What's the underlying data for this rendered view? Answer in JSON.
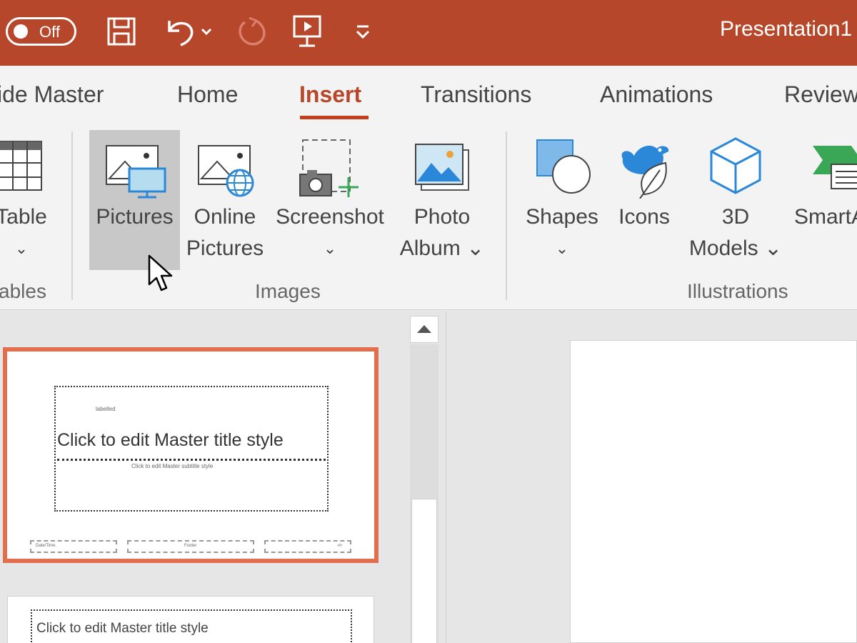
{
  "titlebar": {
    "autosave_label": "Off",
    "document_title": "Presentation1",
    "qat": [
      "save-icon",
      "undo-icon",
      "redo-icon",
      "present-icon",
      "customize-qat-icon"
    ]
  },
  "tabs": [
    {
      "label": "ide Master",
      "active": false
    },
    {
      "label": "Home",
      "active": false
    },
    {
      "label": "Insert",
      "active": true
    },
    {
      "label": "Transitions",
      "active": false
    },
    {
      "label": "Animations",
      "active": false
    },
    {
      "label": "Review",
      "active": false
    }
  ],
  "ribbon": {
    "groups": {
      "tables": "ables",
      "images": "Images",
      "illustrations": "Illustrations"
    },
    "buttons": {
      "table": {
        "line1": "Table",
        "line2": "⌄"
      },
      "pictures": {
        "line1": "Pictures"
      },
      "online_pictures": {
        "line1": "Online",
        "line2": "Pictures"
      },
      "screenshot": {
        "line1": "Screenshot",
        "line2": "⌄"
      },
      "photo_album": {
        "line1": "Photo",
        "line2": "Album ⌄"
      },
      "shapes": {
        "line1": "Shapes",
        "line2": "⌄"
      },
      "icons": {
        "line1": "Icons"
      },
      "models_3d": {
        "line1": "3D",
        "line2": "Models ⌄"
      },
      "smartart": {
        "line1": "SmartA"
      }
    }
  },
  "thumbnails": {
    "slide1": {
      "title": "Click to edit Master title style",
      "subtitle": "Click to edit Master subtitle style",
      "tag": "labelled",
      "footer_left": "Date/Time",
      "footer_center": "Footer",
      "footer_right": "‹#›"
    },
    "slide2": {
      "title": "Click to edit Master title style"
    }
  },
  "colors": {
    "titlebar": "#b7472a",
    "active_tab": "#c43e1c",
    "selected_slide_border": "#e16e4f",
    "hover_button": "#c8c8c8"
  }
}
